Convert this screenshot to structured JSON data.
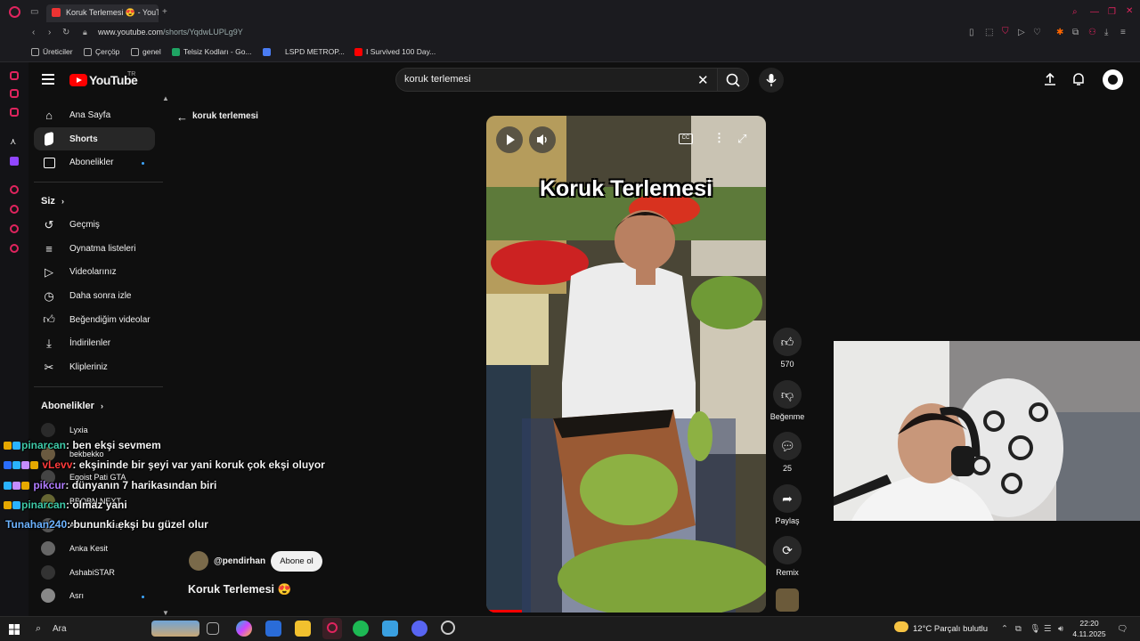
{
  "browser": {
    "tab_title": "Koruk Terlemesi 😍 - YouTube",
    "url_host": "www.youtube.com",
    "url_path": "/shorts/YqdwLUPLg9Y",
    "bookmarks": [
      "Üreticiler",
      "Çerçöp",
      "genel",
      "Telsiz Kodları - Go...",
      "LSPD METROP...",
      "I Survived 100 Day..."
    ]
  },
  "header": {
    "logo": "YouTube",
    "region": "TR",
    "search_value": "koruk terlemesi"
  },
  "sidebar": {
    "main": [
      {
        "label": "Ana Sayfa",
        "icon": "home-icon"
      },
      {
        "label": "Shorts",
        "icon": "shorts-icon"
      },
      {
        "label": "Abonelikler",
        "icon": "subscriptions-icon"
      }
    ],
    "you_title": "Siz",
    "you_items": [
      {
        "label": "Geçmiş",
        "icon": "history-icon"
      },
      {
        "label": "Oynatma listeleri",
        "icon": "playlist-icon"
      },
      {
        "label": "Videolarınız",
        "icon": "your-videos-icon"
      },
      {
        "label": "Daha sonra izle",
        "icon": "watch-later-icon"
      },
      {
        "label": "Beğendiğim videolar",
        "icon": "like-icon"
      },
      {
        "label": "İndirilenler",
        "icon": "download-icon"
      },
      {
        "label": "Klipleriniz",
        "icon": "clips-icon"
      }
    ],
    "subs_title": "Abonelikler",
    "subs": [
      "Lyxia",
      "bekbekko",
      "Egoist Pati GTA",
      "BBOBN NEXT",
      "Anka Kesit Baylar",
      "Anka Kesit",
      "AshabiSTAR",
      "Asrı"
    ]
  },
  "shorts": {
    "back_label": "koruk terlemesi",
    "overlay_title": "Koruk Terlemesi",
    "channel": "@pendirhan",
    "subscribe_label": "Abone ol",
    "title": "Koruk Terlemesi 😍",
    "likes": "570",
    "dislike_label": "Beğenme",
    "comments": "25",
    "share_label": "Paylaş",
    "remix_label": "Remix"
  },
  "chat": [
    {
      "user": "pinarcan",
      "user_color": "#3ec9a7",
      "message": ": ben ekşi sevmem"
    },
    {
      "user": "vLevv",
      "user_color": "#ff3b3b",
      "message": ": ekşininde bir şeyi var yani koruk çok ekşi oluyor"
    },
    {
      "user": "pikcur",
      "user_color": "#b07cff",
      "message": ": dünyanın 7 harikasından biri"
    },
    {
      "user": "pinarcan",
      "user_color": "#3ec9a7",
      "message": ": olmaz yani"
    },
    {
      "user": "Tunahan240",
      "user_color": "#6db3ff",
      "message": ": bununki ekşi bu güzel olur"
    }
  ],
  "taskbar": {
    "search_label": "Ara",
    "weather": "12°C  Parçalı bulutlu",
    "time": "22:20",
    "date": "4.11.2025"
  },
  "colors": {
    "yt_red": "#ff0000",
    "background": "#0f0f0f",
    "accent_link": "#3ea6ff"
  }
}
